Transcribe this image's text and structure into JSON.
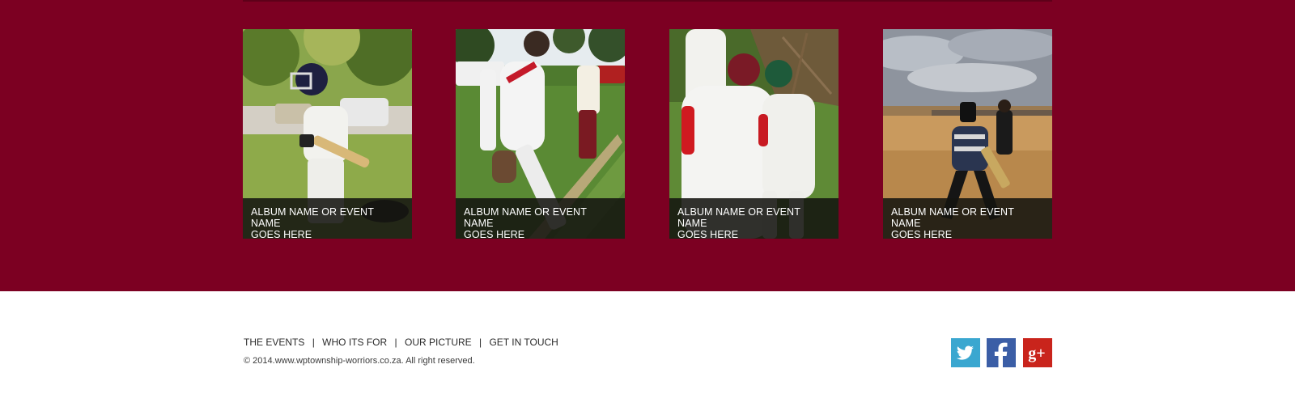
{
  "albums": [
    {
      "caption_line1": "ALBUM NAME OR EVENT NAME",
      "caption_line2": "GOES HERE",
      "photo": "boy-batting-helmet-photo"
    },
    {
      "caption_line1": "ALBUM NAME OR EVENT NAME",
      "caption_line2": "GOES HERE",
      "photo": "boy-with-bat-field-photo"
    },
    {
      "caption_line1": "ALBUM NAME OR EVENT NAME",
      "caption_line2": "GOES HERE",
      "photo": "two-boys-on-field-photo"
    },
    {
      "caption_line1": "ALBUM NAME OR EVENT NAME",
      "caption_line2": "GOES HERE",
      "photo": "boy-batting-dirt-field-photo"
    }
  ],
  "footer": {
    "nav": [
      {
        "label": "THE EVENTS"
      },
      {
        "label": "WHO ITS FOR"
      },
      {
        "label": "OUR PICTURE"
      },
      {
        "label": "GET IN TOUCH"
      }
    ],
    "separator": "|",
    "copyright": "© 2014.www.wptownship-worriors.co.za. All right reserved.",
    "social": [
      {
        "name": "twitter",
        "icon": "twitter-icon",
        "color": "#3aa7d0"
      },
      {
        "name": "facebook",
        "icon": "facebook-icon",
        "color": "#3b5ea6"
      },
      {
        "name": "google-plus",
        "icon": "google-plus-icon",
        "color": "#c9241c",
        "glyph": "g+"
      }
    ]
  },
  "colors": {
    "band": "#7c0022",
    "caption_overlay": "#141410"
  }
}
